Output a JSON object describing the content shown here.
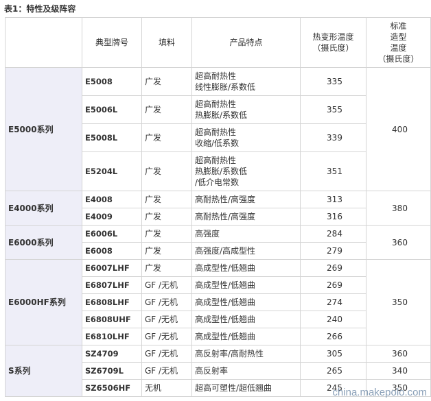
{
  "caption": "表1：特性及级阵容",
  "headers": {
    "grade": "典型牌号",
    "filler": "填料",
    "features": "产品特点",
    "hdt": "热变形温度\n（摄氏度）",
    "molding": "标准\n造型\n温度\n（摄氏度）"
  },
  "groups": [
    {
      "series": "E5000系列",
      "molding": "400",
      "rows": [
        {
          "grade": "E5008",
          "filler": "广发",
          "features": "超高耐热性\n线性膨胀/系数低",
          "hdt": "335"
        },
        {
          "grade": "E5006L",
          "filler": "广发",
          "features": "超高耐热性\n热膨胀/系数低",
          "hdt": "355"
        },
        {
          "grade": "E5008L",
          "filler": "广发",
          "features": "超高耐热性\n收缩/低系数",
          "hdt": "339"
        },
        {
          "grade": "E5204L",
          "filler": "广发",
          "features": "超高耐热性\n热膨胀/系数低\n/低介电常数",
          "hdt": "351"
        }
      ]
    },
    {
      "series": "E4000系列",
      "molding": "380",
      "rows": [
        {
          "grade": "E4008",
          "filler": "广发",
          "features": "高耐热性/高强度",
          "hdt": "313"
        },
        {
          "grade": "E4009",
          "filler": "广发",
          "features": "高耐热性/高强度",
          "hdt": "316"
        }
      ]
    },
    {
      "series": "E6000系列",
      "molding": "360",
      "rows": [
        {
          "grade": "E6006L",
          "filler": "广发",
          "features": "高强度",
          "hdt": "284"
        },
        {
          "grade": "E6008",
          "filler": "广发",
          "features": "高强度/高成型性",
          "hdt": "279"
        }
      ]
    },
    {
      "series": "E6000HF系列",
      "molding": "350",
      "rows": [
        {
          "grade": "E6007LHF",
          "filler": "广发",
          "features": "高成型性/低翘曲",
          "hdt": "269"
        },
        {
          "grade": "E6807LHF",
          "filler": "GF /无机",
          "features": "高成型性/低翘曲",
          "hdt": "269"
        },
        {
          "grade": "E6808LHF",
          "filler": "GF /无机",
          "features": "高成型性/低翘曲",
          "hdt": "274"
        },
        {
          "grade": "E6808UHF",
          "filler": "GF /无机",
          "features": "高成型性/低翘曲",
          "hdt": "240"
        },
        {
          "grade": "E6810LHF",
          "filler": "GF /无机",
          "features": "高成型性/低翘曲",
          "hdt": "266"
        }
      ]
    },
    {
      "series": "S系列",
      "rows": [
        {
          "grade": "SZ4709",
          "filler": "GF /无机",
          "features": "高反射率/高耐热性",
          "hdt": "305",
          "molding": "360"
        },
        {
          "grade": "SZ6709L",
          "filler": "GF /无机",
          "features": "高反射率",
          "hdt": "265",
          "molding": "340"
        },
        {
          "grade": "SZ6506HF",
          "filler": "无机",
          "features": "超高可塑性/超低翘曲",
          "hdt": "245",
          "molding": "350"
        }
      ]
    }
  ],
  "watermark": "china.makepolo.com"
}
